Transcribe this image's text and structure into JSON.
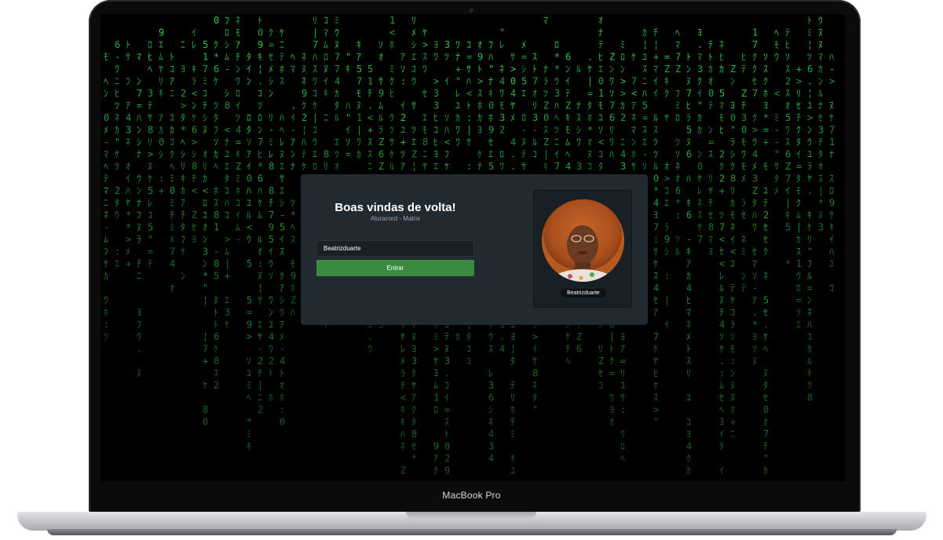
{
  "device": {
    "brand_label": "MacBook Pro"
  },
  "login": {
    "title": "Boas vindas de volta!",
    "subtitle": "Aluracord - Matrix",
    "username_value": "Beatrizduarte",
    "submit_label": "Entrar"
  },
  "profile": {
    "username": "Beatrizduarte"
  },
  "colors": {
    "matrix_green": "#2fd34a",
    "card_background": "#212931",
    "panel_background": "#181f25",
    "button_green": "#3a8a3f"
  },
  "background": {
    "glyphs": "ｱｲｳｴｵｶｷｸｹｺｻｼｽｾｿﾀﾁﾂﾃﾄﾅﾆﾇﾈﾊﾋﾌﾍﾎﾏﾐﾑﾒﾓﾔﾕﾖﾗﾘﾙﾚﾛﾜﾝ0123456789Z:.\"=*+-<>¦|"
  }
}
